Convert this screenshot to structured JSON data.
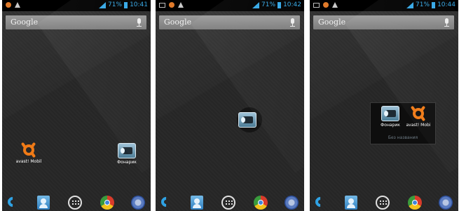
{
  "screens": [
    {
      "status_time": "10:41",
      "battery_text": "71%",
      "search_label": "Google",
      "apps": [
        {
          "label": "avast! Mobil",
          "icon": "avast-icon"
        },
        {
          "label": "Фонарик",
          "icon": "flashlight-icon"
        }
      ],
      "dock": [
        "phone-icon",
        "contacts-icon",
        "all-apps-icon",
        "chrome-icon",
        "browser-icon"
      ]
    },
    {
      "status_time": "10:42",
      "battery_text": "71%",
      "search_label": "Google",
      "dragging": {
        "icon": "flashlight-icon"
      },
      "dock": [
        "phone-icon",
        "contacts-icon",
        "all-apps-icon",
        "chrome-icon",
        "browser-icon"
      ]
    },
    {
      "status_time": "10:44",
      "battery_text": "71%",
      "search_label": "Google",
      "folder": {
        "apps": [
          {
            "label": "Фонарик",
            "icon": "flashlight-icon"
          },
          {
            "label": "avast! Mobi",
            "icon": "avast-icon"
          }
        ],
        "name": "Без названия"
      },
      "dock": [
        "phone-icon",
        "contacts-icon",
        "all-apps-icon",
        "chrome-icon",
        "browser-icon"
      ]
    }
  ],
  "colors": {
    "status_accent": "#35a8e6",
    "avast_orange": "#f07a16"
  }
}
